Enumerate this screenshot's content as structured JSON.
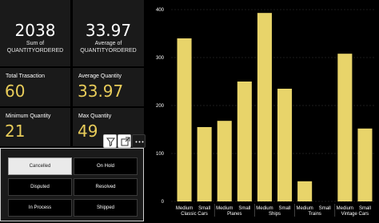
{
  "cards": {
    "sum_quantity": {
      "value": "2038",
      "label": "Sum of QUANTITYORDERED"
    },
    "avg_quantity": {
      "value": "33.97",
      "label_line1": "Average of",
      "label_line2": "QUANTITYORDERED"
    }
  },
  "kpis": {
    "total_transaction": {
      "label": "Total Trasaction",
      "value": "60"
    },
    "average_quantity": {
      "label": "Average Quantity",
      "value": "33.97"
    },
    "minimum_quantity": {
      "label": "Minimum Quantity",
      "value": "21"
    },
    "max_quantity": {
      "label": "Max Quantity",
      "value": "49"
    }
  },
  "visual_header_icons": [
    "filter-icon",
    "focus-mode-icon",
    "more-options-icon"
  ],
  "slicer": {
    "items": [
      {
        "label": "Cancelled",
        "selected": true
      },
      {
        "label": "On Hold",
        "selected": false
      },
      {
        "label": "Disputed",
        "selected": false
      },
      {
        "label": "Resolved",
        "selected": false
      },
      {
        "label": "In Process",
        "selected": false
      },
      {
        "label": "Shipped",
        "selected": false
      }
    ]
  },
  "colors": {
    "accent": "#e8cc5a",
    "bar": "#e8d46a",
    "card_bg": "#1a1a1a",
    "page_bg": "#000000"
  },
  "chart_data": {
    "type": "bar",
    "title": "",
    "xlabel": "",
    "ylabel": "",
    "ylim": [
      0,
      400
    ],
    "yticks": [
      0,
      100,
      200,
      300,
      400
    ],
    "grid": true,
    "groups": [
      {
        "name": "Classic Cars",
        "categories": [
          "Medium",
          "Small"
        ]
      },
      {
        "name": "Planes",
        "categories": [
          "Medium",
          "Small"
        ]
      },
      {
        "name": "Ships",
        "categories": [
          "Medium",
          "Small"
        ]
      },
      {
        "name": "Trains",
        "categories": [
          "Medium",
          "Small"
        ]
      },
      {
        "name": "Vintage Cars",
        "categories": [
          "Medium",
          "Small"
        ]
      }
    ],
    "values": [
      340,
      155,
      168,
      250,
      393,
      235,
      42,
      0,
      308,
      152
    ]
  }
}
